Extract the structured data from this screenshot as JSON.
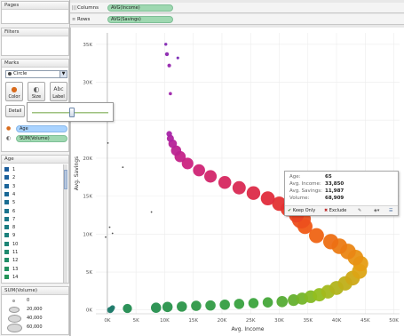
{
  "panes": {
    "pages_title": "Pages",
    "filters_title": "Filters",
    "marks_title": "Marks",
    "mark_type": "Circle",
    "buttons": {
      "color": "Color",
      "size": "Size",
      "label": "Label",
      "detail": "Detail"
    },
    "mark_fields": [
      "Age",
      "SUM(Volume)"
    ]
  },
  "shelves": {
    "columns_label": "Columns",
    "columns_value": "AVG(Income)",
    "rows_label": "Rows",
    "rows_value": "AVG(Savings)"
  },
  "age_legend": {
    "title": "Age",
    "items": [
      "1",
      "2",
      "3",
      "4",
      "5",
      "6",
      "7",
      "8",
      "9",
      "10",
      "11",
      "12",
      "13",
      "14"
    ],
    "colors": [
      "#1c5d9c",
      "#1b609c",
      "#1b6499",
      "#1a6896",
      "#1a6d92",
      "#19728d",
      "#197788",
      "#1a7c82",
      "#1b807c",
      "#1c8575",
      "#1e896e",
      "#208d67",
      "#229160",
      "#249458"
    ]
  },
  "size_legend": {
    "title": "SUM(Volume)",
    "items": [
      "0",
      "20,000",
      "40,000",
      "60,000"
    ]
  },
  "tooltip": {
    "fields": [
      {
        "key": "Age:",
        "value": "65"
      },
      {
        "key": "Avg. Income:",
        "value": "33,850"
      },
      {
        "key": "Avg. Savings:",
        "value": "11,987"
      },
      {
        "key": "Volume:",
        "value": "68,909"
      }
    ],
    "keep_only": "Keep Only",
    "exclude": "Exclude"
  },
  "chart_data": {
    "type": "scatter",
    "xlabel": "Avg. Income",
    "ylabel": "Avg. Savings",
    "x_ticks": [
      "0K",
      "5K",
      "10K",
      "15K",
      "20K",
      "25K",
      "30K",
      "35K",
      "40K",
      "45K",
      "50K"
    ],
    "y_ticks": [
      "0K",
      "5K",
      "10K",
      "15K",
      "20K",
      "25K",
      "30K",
      "35K"
    ],
    "xlim": [
      -2000,
      51000
    ],
    "ylim": [
      -500,
      36500
    ],
    "grid": true,
    "series": [
      {
        "points": [
          {
            "x": 100,
            "y": 22000,
            "v": 0,
            "age": 1
          },
          {
            "x": -300,
            "y": 9600,
            "v": 0,
            "age": 2
          },
          {
            "x": 400,
            "y": 10900,
            "v": 0,
            "age": 3
          },
          {
            "x": 900,
            "y": 10100,
            "v": 0,
            "age": 4
          },
          {
            "x": 2700,
            "y": 18800,
            "v": 0,
            "age": 5
          },
          {
            "x": 7700,
            "y": 12900,
            "v": 0,
            "age": 6
          },
          {
            "x": 900,
            "y": 300,
            "v": 2000,
            "age": 7
          },
          {
            "x": 700,
            "y": 100,
            "v": 3000,
            "age": 8
          },
          {
            "x": 500,
            "y": 0,
            "v": 4000,
            "age": 9
          },
          {
            "x": 3500,
            "y": 200,
            "v": 12000,
            "age": 10
          },
          {
            "x": 8500,
            "y": 300,
            "v": 16000,
            "age": 11
          },
          {
            "x": 10500,
            "y": 400,
            "v": 16000,
            "age": 12
          },
          {
            "x": 13000,
            "y": 450,
            "v": 16000,
            "age": 13
          },
          {
            "x": 15500,
            "y": 550,
            "v": 16000,
            "age": 14
          },
          {
            "x": 18000,
            "y": 600,
            "v": 16000,
            "age": 15
          },
          {
            "x": 20500,
            "y": 700,
            "v": 16000,
            "age": 16
          },
          {
            "x": 23000,
            "y": 800,
            "v": 16000,
            "age": 17
          },
          {
            "x": 25500,
            "y": 900,
            "v": 16000,
            "age": 18
          },
          {
            "x": 28000,
            "y": 1000,
            "v": 16000,
            "age": 19
          },
          {
            "x": 30500,
            "y": 1100,
            "v": 20000,
            "age": 20
          },
          {
            "x": 32500,
            "y": 1300,
            "v": 22000,
            "age": 21
          },
          {
            "x": 34000,
            "y": 1500,
            "v": 24000,
            "age": 22
          },
          {
            "x": 35500,
            "y": 1750,
            "v": 27000,
            "age": 23
          },
          {
            "x": 37000,
            "y": 2000,
            "v": 30000,
            "age": 24
          },
          {
            "x": 38500,
            "y": 2400,
            "v": 32000,
            "age": 25
          },
          {
            "x": 40000,
            "y": 2900,
            "v": 34000,
            "age": 26
          },
          {
            "x": 41500,
            "y": 3500,
            "v": 36000,
            "age": 27
          },
          {
            "x": 42800,
            "y": 4200,
            "v": 38000,
            "age": 28
          },
          {
            "x": 44000,
            "y": 5100,
            "v": 40000,
            "age": 29
          },
          {
            "x": 44200,
            "y": 6100,
            "v": 42000,
            "age": 30
          },
          {
            "x": 43300,
            "y": 6900,
            "v": 44000,
            "age": 31
          },
          {
            "x": 42000,
            "y": 7700,
            "v": 44000,
            "age": 32
          },
          {
            "x": 40500,
            "y": 8400,
            "v": 44000,
            "age": 33
          },
          {
            "x": 39000,
            "y": 9000,
            "v": 42000,
            "age": 34
          },
          {
            "x": 36500,
            "y": 9800,
            "v": 40000,
            "age": 35
          },
          {
            "x": 34500,
            "y": 11000,
            "v": 40000,
            "age": 36
          },
          {
            "x": 33850,
            "y": 11987,
            "v": 68909,
            "age": 65
          },
          {
            "x": 33000,
            "y": 12500,
            "v": 40000,
            "age": 37
          },
          {
            "x": 31500,
            "y": 13300,
            "v": 38000,
            "age": 38
          },
          {
            "x": 30000,
            "y": 14000,
            "v": 36000,
            "age": 39
          },
          {
            "x": 28000,
            "y": 14700,
            "v": 34000,
            "age": 40
          },
          {
            "x": 25500,
            "y": 15400,
            "v": 32000,
            "age": 41
          },
          {
            "x": 23000,
            "y": 16100,
            "v": 30000,
            "age": 42
          },
          {
            "x": 20500,
            "y": 16800,
            "v": 28000,
            "age": 43
          },
          {
            "x": 18000,
            "y": 17600,
            "v": 26000,
            "age": 44
          },
          {
            "x": 16000,
            "y": 18400,
            "v": 24000,
            "age": 45
          },
          {
            "x": 14000,
            "y": 19300,
            "v": 22000,
            "age": 46
          },
          {
            "x": 12700,
            "y": 20200,
            "v": 20000,
            "age": 47
          },
          {
            "x": 12000,
            "y": 21000,
            "v": 16000,
            "age": 48
          },
          {
            "x": 11400,
            "y": 21900,
            "v": 10000,
            "age": 49
          },
          {
            "x": 11000,
            "y": 22600,
            "v": 6000,
            "age": 50
          },
          {
            "x": 10800,
            "y": 23200,
            "v": 3000,
            "age": 51
          },
          {
            "x": 11000,
            "y": 28500,
            "v": 300,
            "age": 52
          },
          {
            "x": 10800,
            "y": 32200,
            "v": 600,
            "age": 53
          },
          {
            "x": 10400,
            "y": 33700,
            "v": 800,
            "age": 54
          },
          {
            "x": 10200,
            "y": 35000,
            "v": 200,
            "age": 55
          },
          {
            "x": 12300,
            "y": 33200,
            "v": 100,
            "age": 56
          }
        ]
      }
    ]
  }
}
